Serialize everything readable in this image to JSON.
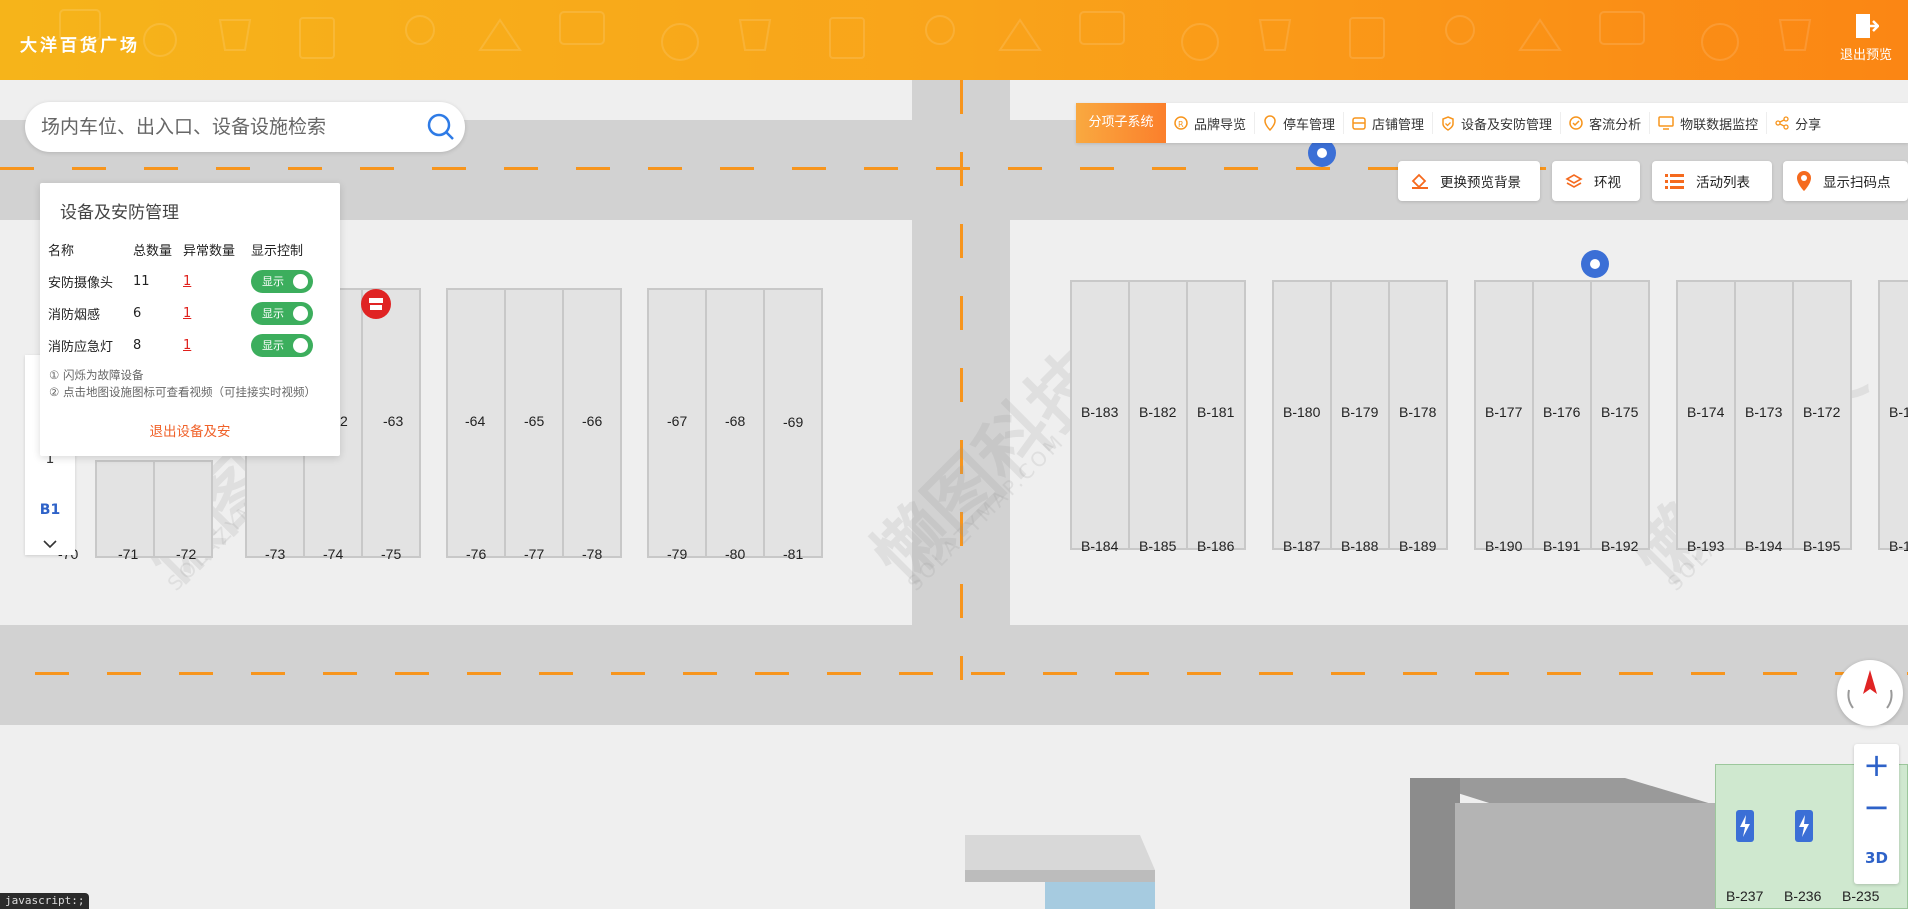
{
  "header": {
    "title": "大洋百货广场",
    "exit_preview": "退出预览"
  },
  "search": {
    "placeholder": "场内车位、出入口、设备设施检索"
  },
  "subnav": {
    "head": "分项子系统",
    "items": [
      {
        "label": "品牌导览",
        "icon": "brand-icon"
      },
      {
        "label": "停车管理",
        "icon": "parking-pin-icon"
      },
      {
        "label": "店铺管理",
        "icon": "store-icon"
      },
      {
        "label": "设备及安防管理",
        "icon": "shield-icon"
      },
      {
        "label": "客流分析",
        "icon": "check-circle-icon"
      },
      {
        "label": "物联数据监控",
        "icon": "monitor-icon"
      },
      {
        "label": "分享",
        "icon": "share-icon"
      }
    ]
  },
  "toolbar": {
    "change_bg": "更换预览背景",
    "surround": "环视",
    "activity_list": "活动列表",
    "show_scan": "显示扫码点"
  },
  "panel": {
    "title": "设备及安防管理",
    "columns": [
      "名称",
      "总数量",
      "异常数量",
      "显示控制"
    ],
    "rows": [
      {
        "name": "安防摄像头",
        "total": "11",
        "abnormal": "1",
        "toggle": "显示"
      },
      {
        "name": "消防烟感",
        "total": "6",
        "abnormal": "1",
        "toggle": "显示"
      },
      {
        "name": "消防应急灯",
        "total": "8",
        "abnormal": "1",
        "toggle": "显示"
      }
    ],
    "note1": "① 闪烁为故障设备",
    "note2": "② 点击地图设施图标可查看视频（可挂接实时视频）",
    "exit": "退出设备及安"
  },
  "floors": {
    "items": [
      "1",
      "B1"
    ],
    "active": "B1"
  },
  "zoom": {
    "plus": "+",
    "minus": "−",
    "mode": "3D"
  },
  "status": "javascript:;",
  "map": {
    "left_top_labels": [
      "-63",
      "-64",
      "-65",
      "-66",
      "-67",
      "-68",
      "-69"
    ],
    "left_bottom_labels": [
      "-70",
      "-71",
      "-72",
      "-73",
      "-74",
      "-75",
      "-76",
      "-77",
      "-78",
      "-79",
      "-80",
      "-81"
    ],
    "right_top_labels": [
      "B-183",
      "B-182",
      "B-181",
      "B-180",
      "B-179",
      "B-178",
      "B-177",
      "B-176",
      "B-175",
      "B-174",
      "B-173",
      "B-172",
      "B-1"
    ],
    "right_bottom_labels": [
      "B-184",
      "B-185",
      "B-186",
      "B-187",
      "B-188",
      "B-189",
      "B-190",
      "B-191",
      "B-192",
      "B-193",
      "B-194",
      "B-195",
      "B-1"
    ],
    "bottom_labels": [
      "B-237",
      "B-236",
      "B-235"
    ],
    "watermark": "懒图科技",
    "watermark_sub": "SOLAZYMAP.COM",
    "fragment_label": "2"
  }
}
